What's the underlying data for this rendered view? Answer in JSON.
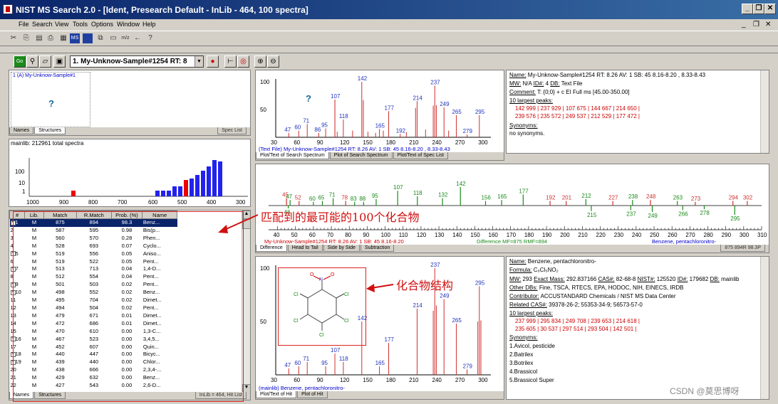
{
  "window": {
    "title": "NIST MS Search 2.0 - [Ident, Presearch Default - InLib - 464, 100 spectra]",
    "min": "_",
    "max": "❐",
    "close": "✕"
  },
  "menu": [
    "File",
    "Search",
    "View",
    "Tools",
    "Options",
    "Window",
    "Help"
  ],
  "toolbar2": {
    "spectrum_combo": "1. My-Unknow-Sample#1254  RT: 8"
  },
  "names_panel": {
    "item": "1 (A) My-Unknow-Sample#1",
    "tabs": [
      "Names",
      "Structures"
    ],
    "right": "Spec List",
    "question": "?"
  },
  "histogram": {
    "caption": "mainlib: 212961 total spectra"
  },
  "hitlist": {
    "columns": [
      "#",
      "Lib.",
      "Match",
      "R.Match",
      "Prob. (%)",
      "Name"
    ],
    "rows": [
      [
        "1",
        "M",
        "875",
        "894",
        "98.3",
        "Benz..."
      ],
      [
        "2",
        "M",
        "587",
        "595",
        "0.98",
        "Bis(p..."
      ],
      [
        "3",
        "M",
        "560",
        "570",
        "0.28",
        "Phen..."
      ],
      [
        "4",
        "M",
        "528",
        "693",
        "0.07",
        "Cyclo..."
      ],
      [
        "5",
        "M",
        "519",
        "556",
        "0.05",
        "Aniso..."
      ],
      [
        "6",
        "M",
        "519",
        "522",
        "0.05",
        "Pent..."
      ],
      [
        "7",
        "M",
        "513",
        "713",
        "0.04",
        "1,4-D..."
      ],
      [
        "8",
        "M",
        "512",
        "554",
        "0.04",
        "Pent..."
      ],
      [
        "9",
        "M",
        "501",
        "503",
        "0.02",
        "Pent..."
      ],
      [
        "10",
        "M",
        "498",
        "552",
        "0.02",
        "Benz..."
      ],
      [
        "11",
        "M",
        "495",
        "704",
        "0.02",
        "Dimet..."
      ],
      [
        "12",
        "M",
        "494",
        "504",
        "0.02",
        "Pent..."
      ],
      [
        "13",
        "M",
        "479",
        "671",
        "0.01",
        "Dimet..."
      ],
      [
        "14",
        "M",
        "472",
        "686",
        "0.01",
        "Dimet..."
      ],
      [
        "15",
        "M",
        "470",
        "610",
        "0.00",
        "1,3-C..."
      ],
      [
        "16",
        "M",
        "467",
        "523",
        "0.00",
        "3,4,5..."
      ],
      [
        "17",
        "M",
        "452",
        "607",
        "0.00",
        "Quin..."
      ],
      [
        "18",
        "M",
        "440",
        "447",
        "0.00",
        "Bicyc..."
      ],
      [
        "19",
        "M",
        "439",
        "440",
        "0.00",
        "Chlor..."
      ],
      [
        "20",
        "M",
        "438",
        "666",
        "0.00",
        "2,3,4-..."
      ],
      [
        "21",
        "M",
        "429",
        "632",
        "0.00",
        "Benz..."
      ],
      [
        "22",
        "M",
        "427",
        "543",
        "0.00",
        "2,6-D..."
      ]
    ],
    "plus_rows": [
      1,
      5,
      7,
      9,
      10,
      16,
      18,
      19
    ],
    "tabs": [
      "Names",
      "Structures"
    ],
    "status": "InLib = 464, Hit List"
  },
  "top_spectrum": {
    "caption": "(Text File) My-Unknow-Sample#1254  RT: 8.26  AV: 1 SB: 45  8.16-8.20 , 8.33-8.43",
    "tabs": [
      "Plot/Text of Search Spectrum",
      "Plot of Search Spectrum",
      "Plot/Text of Spec List"
    ],
    "question": "?"
  },
  "top_info": {
    "name_label": "Name:",
    "name": "My-Unknow-Sample#1254  RT: 8.26  AV: 1 SB: 45  8.16-8.20 , 8.33-8.43",
    "mw_label": "MW:",
    "mw": "N/A",
    "id_label": "ID#:",
    "id": "4",
    "db_label": "DB:",
    "db": "Text File",
    "comment_label": "Comment:",
    "comment": "T: {0;0}  + c EI Full ms [45.00-350.00]",
    "largest_label": "10 largest peaks:",
    "peaks1": "142 999 |  237 929 |  107 675 |  144 667 |  214 650 |",
    "peaks2": "239 576 |  235 572 |  249 537 |  212 529 |  177 472 |",
    "syn_label": "Synonyms:",
    "syn": "no synonyms."
  },
  "diff_panel": {
    "caption": "My-Unknow-Sample#1254  RT: 8.26  AV: 1 SB: 45  8.16-8.20",
    "diff": "Difference MF=875 RMF=894",
    "compound": "Benzene, pentachloronitro-",
    "score": "875 894R 98.3P",
    "tabs": [
      "Difference",
      "Head to Tail",
      "Side by Side",
      "Subtraction"
    ]
  },
  "bottom_spectrum": {
    "caption": "(mainlib) Benzene, pentachloronitro-",
    "tabs": [
      "Plot/Text of Hit",
      "Plot of Hit"
    ]
  },
  "bottom_info": {
    "name_label": "Name:",
    "name": "Benzene, pentachloronitro-",
    "formula_label": "Formula:",
    "formula": "C₆Cl₅NO₂",
    "mw_label": "MW:",
    "mw": "293",
    "exact_label": "Exact Mass:",
    "exact": "292.837166",
    "cas_label": "CAS#:",
    "cas": "82-68-8",
    "nist_label": "NIST#:",
    "nist": "125520",
    "id_label": "ID#:",
    "id": "179682",
    "db_label": "DB:",
    "db": "mainlib",
    "otherdb_label": "Other DBs:",
    "otherdb": "Fine, TSCA, RTECS, EPA, HODOC, NIH, EINECS, IRDB",
    "contrib_label": "Contributor:",
    "contrib": "ACCUSTANDARD Chemicals / NIST MS Data Center",
    "related_label": "Related CAS#:",
    "related": "39378-26-2; 55353-34-9; 56573-57-0",
    "largest_label": "10 largest peaks:",
    "peaks1": "237 999 |  295 834 |  249 708 |  239 653 |  214 618 |",
    "peaks2": "235 605 |   30 537 |  297 514 |  293 504 |  142 501 |",
    "syn_label": "Synonyms:",
    "synonyms": [
      "1.Avicol, pesticide",
      "2.Batrilex",
      "3.Botrilex",
      "4.Brassicol",
      "5.Brassicol Super"
    ]
  },
  "annotations": {
    "hits_note": "匹配到的最可能的100个化合物",
    "structure_note": "化合物结构"
  },
  "watermark": "CSDN @莫思博呀"
}
